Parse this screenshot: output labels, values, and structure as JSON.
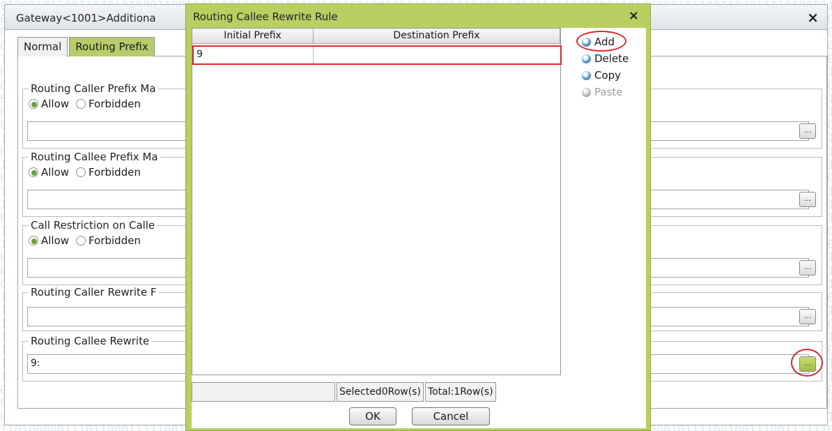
{
  "outer_window": {
    "title": "Gateway<1001>Additiona",
    "close_glyph": "×",
    "tabs": [
      {
        "label": "Normal",
        "active": false
      },
      {
        "label": "Routing Prefix",
        "active": true
      }
    ],
    "groups": [
      {
        "title": "Routing Caller Prefix Ma",
        "allow_label": "Allow",
        "forbidden_label": "Forbidden",
        "selected": "Allow",
        "value": ""
      },
      {
        "title": "Routing Callee Prefix Ma",
        "allow_label": "Allow",
        "forbidden_label": "Forbidden",
        "selected": "Allow",
        "value": ""
      },
      {
        "title": "Call Restriction on Calle",
        "allow_label": "Allow",
        "forbidden_label": "Forbidden",
        "selected": "Allow",
        "value": ""
      },
      {
        "title": "Routing Caller Rewrite F",
        "value": ""
      },
      {
        "title": "Routing Callee Rewrite",
        "value": "9:"
      }
    ],
    "browse_label": "..."
  },
  "modal": {
    "title": "Routing Callee Rewrite Rule",
    "close_glyph": "×",
    "columns": [
      "Initial Prefix",
      "Destination Prefix"
    ],
    "rows": [
      {
        "initial_prefix": "9",
        "destination_prefix": ""
      }
    ],
    "actions": [
      {
        "label": "Add",
        "enabled": true,
        "icon": "add-icon"
      },
      {
        "label": "Delete",
        "enabled": true,
        "icon": "delete-icon"
      },
      {
        "label": "Copy",
        "enabled": true,
        "icon": "copy-icon"
      },
      {
        "label": "Paste",
        "enabled": false,
        "icon": "paste-icon"
      }
    ],
    "status": {
      "selected": "Selected0Row(s)",
      "total": "Total:1Row(s)"
    },
    "ok_label": "OK",
    "cancel_label": "Cancel"
  },
  "colors": {
    "accent_green": "#b9cf62",
    "highlight_red": "#d42a2a"
  }
}
